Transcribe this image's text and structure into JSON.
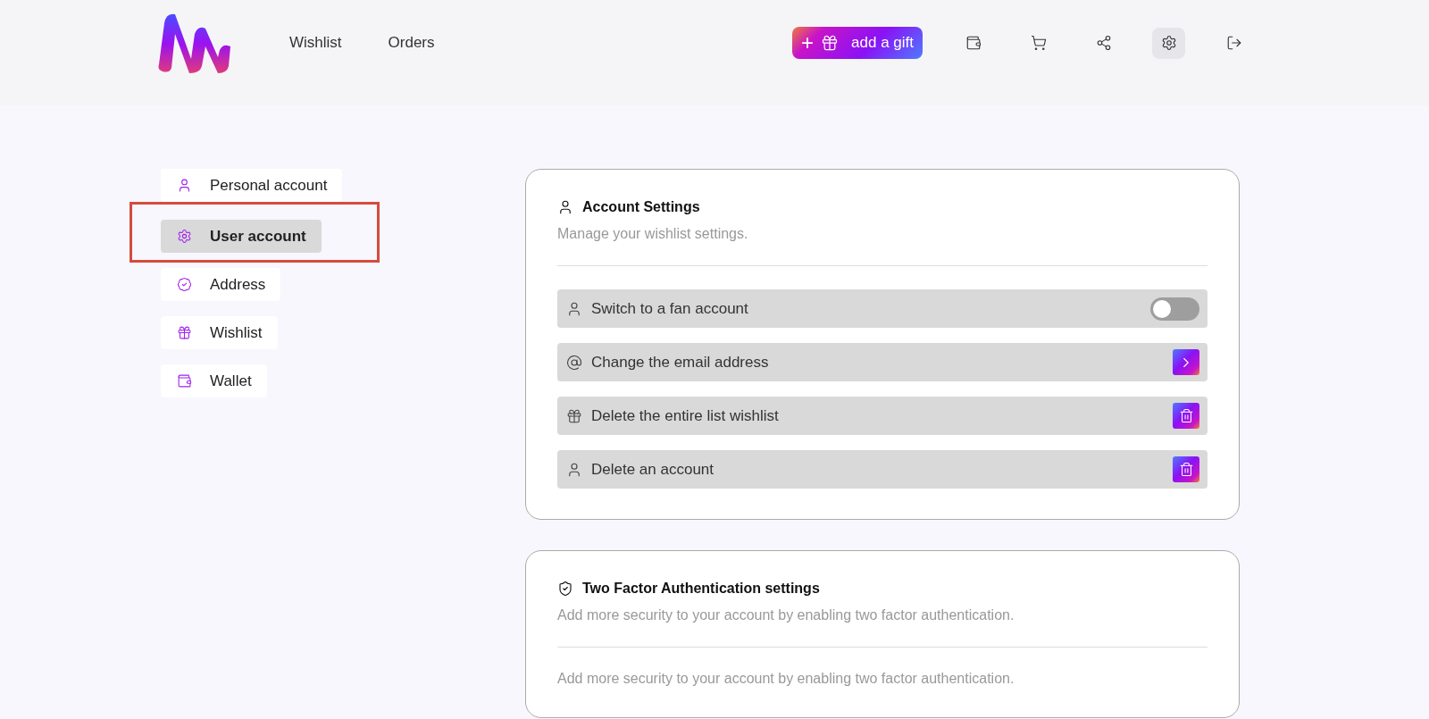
{
  "header": {
    "nav": [
      {
        "label": "Wishlist"
      },
      {
        "label": "Orders"
      }
    ],
    "add_button": {
      "plus": "+",
      "label": "add a gift"
    },
    "tools": [
      {
        "kind": "wallet",
        "selected": false
      },
      {
        "kind": "cart",
        "selected": false
      },
      {
        "kind": "share",
        "selected": false
      },
      {
        "kind": "settings",
        "selected": true
      },
      {
        "kind": "logout",
        "selected": false
      }
    ]
  },
  "sidebar": {
    "items": [
      {
        "label": "Personal account",
        "kind": "user",
        "selected": false,
        "annotated": false
      },
      {
        "label": "User account",
        "kind": "settings",
        "selected": true,
        "annotated": true
      },
      {
        "label": "Address",
        "kind": "badge",
        "selected": false,
        "annotated": false
      },
      {
        "label": "Wishlist",
        "kind": "gift",
        "selected": false,
        "annotated": false
      },
      {
        "label": "Wallet",
        "kind": "wallet",
        "selected": false,
        "annotated": false
      }
    ]
  },
  "cards": [
    {
      "kind": "account",
      "title": "Account Settings",
      "subtitle": "Manage your wishlist settings.",
      "rows": [
        {
          "label": "Switch to a fan account",
          "kind": "toggle",
          "on": false
        },
        {
          "label": "Change the email address",
          "kind": "email"
        },
        {
          "label": "Delete the entire list wishlist",
          "kind": "delete-list"
        },
        {
          "label": "Delete an account",
          "kind": "delete-account"
        }
      ]
    },
    {
      "kind": "security",
      "title": "Two Factor Authentication settings",
      "subtitle": "Add more security to your account by enabling two factor authentication.",
      "note": "Add more security to your account by enabling two factor authentication."
    }
  ]
}
